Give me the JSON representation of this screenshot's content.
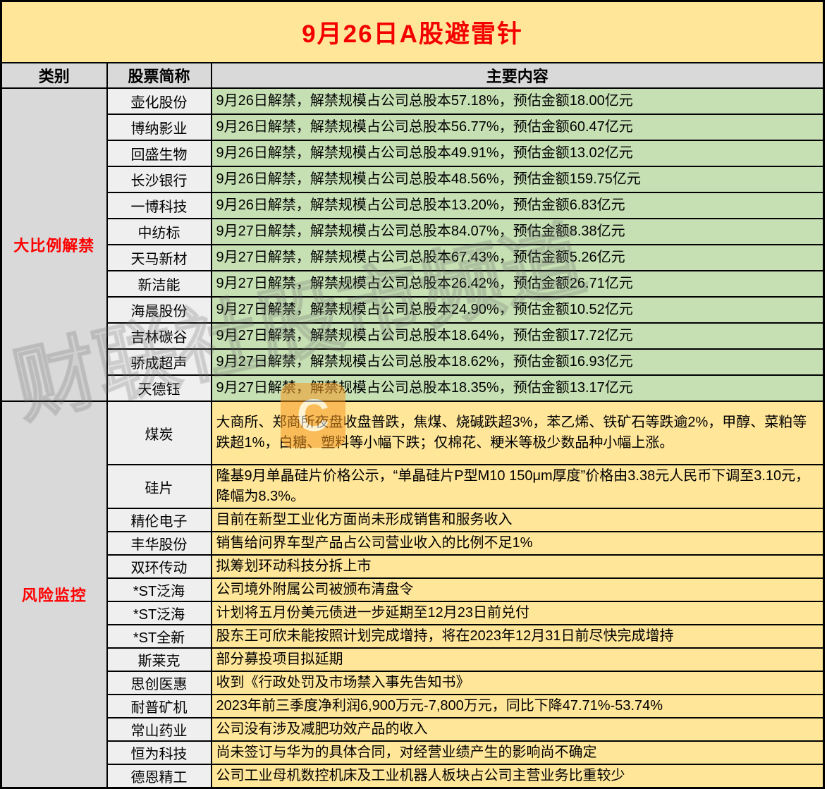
{
  "title": "9月26日A股避雷针",
  "columns": {
    "category": "类别",
    "stock": "股票简称",
    "content": "主要内容"
  },
  "sections": [
    {
      "category": "大比例解禁",
      "style": "green",
      "rows": [
        {
          "stock": "壶化股份",
          "content": "9月26日解禁，解禁规模占公司总股本57.18%，预估金额18.00亿元"
        },
        {
          "stock": "博纳影业",
          "content": "9月26日解禁，解禁规模占公司总股本56.77%，预估金额60.47亿元"
        },
        {
          "stock": "回盛生物",
          "content": "9月26日解禁，解禁规模占公司总股本49.91%，预估金额13.02亿元"
        },
        {
          "stock": "长沙银行",
          "content": "9月26日解禁，解禁规模占公司总股本48.56%，预估金额159.75亿元"
        },
        {
          "stock": "一博科技",
          "content": "9月26日解禁，解禁规模占公司总股本13.20%，预估金额6.83亿元"
        },
        {
          "stock": "中纺标",
          "content": "9月27日解禁，解禁规模占公司总股本84.07%，预估金额8.38亿元"
        },
        {
          "stock": "天马新材",
          "content": "9月27日解禁，解禁规模占公司总股本67.43%，预估金额5.26亿元"
        },
        {
          "stock": "新洁能",
          "content": "9月27日解禁，解禁规模占公司总股本26.42%，预估金额26.71亿元"
        },
        {
          "stock": "海晨股份",
          "content": "9月27日解禁，解禁规模占公司总股本24.90%，预估金额10.52亿元"
        },
        {
          "stock": "吉林碳谷",
          "content": "9月27日解禁，解禁规模占公司总股本18.64%，预估金额17.72亿元"
        },
        {
          "stock": "骄成超声",
          "content": "9月27日解禁，解禁规模占公司总股本18.62%，预估金额16.93亿元"
        },
        {
          "stock": "天德钰",
          "content": "9月27日解禁，解禁规模占公司总股本18.35%，预估金额13.17亿元"
        }
      ]
    },
    {
      "category": "风险监控",
      "style": "yellow",
      "rows": [
        {
          "stock": "煤炭",
          "content": "大商所、郑商所夜盘收盘普跌，焦煤、烧碱跌超3%，苯乙烯、铁矿石等跌逾2%，甲醇、菜粕等跌超1%，白糖、塑料等小幅下跌；仅棉花、粳米等极少数品种小幅上涨。",
          "size": "h3"
        },
        {
          "stock": "硅片",
          "content": "隆基9月单晶硅片价格公示，“单晶硅片P型M10 150μm厚度”价格由3.38元人民币下调至3.10元，降幅为8.3%。",
          "size": "h2"
        },
        {
          "stock": "精伦电子",
          "content": "目前在新型工业化方面尚未形成销售和服务收入"
        },
        {
          "stock": "丰华股份",
          "content": "销售给问界车型产品占公司营业收入的比例不足1%"
        },
        {
          "stock": "双环传动",
          "content": "拟筹划环动科技分拆上市"
        },
        {
          "stock": "*ST泛海",
          "content": "公司境外附属公司被颁布清盘令"
        },
        {
          "stock": "*ST泛海",
          "content": "计划将五月份美元债进一步延期至12月23日前兑付"
        },
        {
          "stock": "*ST全新",
          "content": "股东王可欣未能按照计划完成增持，将在2023年12月31日前尽快完成增持"
        },
        {
          "stock": "斯莱克",
          "content": "部分募投项目拟延期"
        },
        {
          "stock": "思创医惠",
          "content": "收到《行政处罚及市场禁入事先告知书》"
        },
        {
          "stock": "耐普矿机",
          "content": "2023年前三季度净利润6,900万元-7,800万元，同比下降47.71%-53.74%"
        },
        {
          "stock": "常山药业",
          "content": "公司没有涉及减肥功效产品的收入"
        },
        {
          "stock": "恒为科技",
          "content": "尚未签订与华为的具体合同，对经营业绩产生的影响尚不确定"
        },
        {
          "stock": "德恩精工",
          "content": "公司工业母机数控机床及工业机器人板块占公司主营业务比重较少"
        }
      ]
    }
  ],
  "watermark": {
    "text": "财联社股市频道",
    "logo_letter": "C"
  },
  "colors": {
    "title_bg": "#FFE699",
    "title_text": "#F40000",
    "header_bg": "#D9D9D9",
    "category_bg": "#D9D9D9",
    "category_text": "#FE0000",
    "stock_bg": "#EFEFEF",
    "green_row_bg": "#C6E0B4",
    "yellow_row_bg": "#FFE699",
    "border": "#000000",
    "logo_orange": "#F59A23"
  }
}
